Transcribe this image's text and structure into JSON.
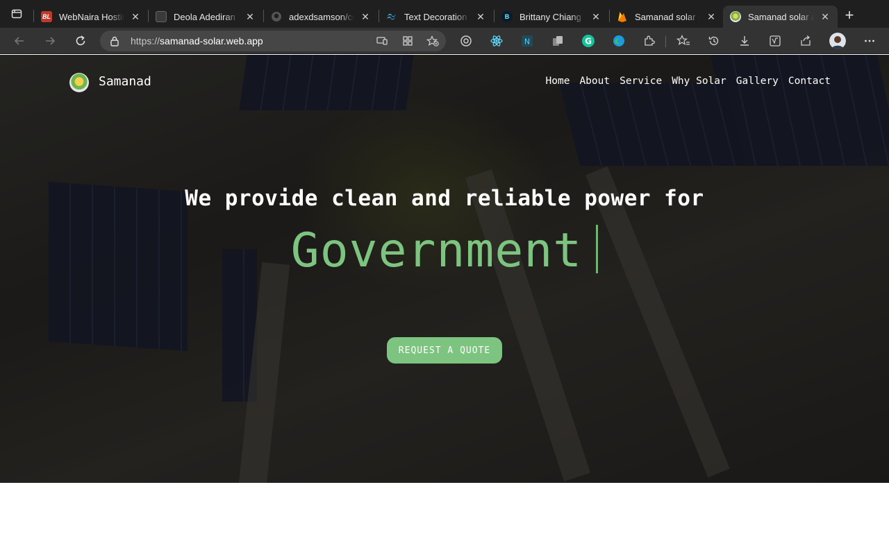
{
  "browser": {
    "tabs": [
      {
        "title": "WebNaira Hosting",
        "favicon": "bl-logo-icon",
        "fav_text": "BL",
        "color": "#c0392b"
      },
      {
        "title": "Deola Adediran | A",
        "favicon": "dark-square-icon",
        "fav_text": "",
        "color": "#444444"
      },
      {
        "title": "adexdsamson/cre",
        "favicon": "github-icon",
        "fav_text": "",
        "color": "#1f1f1f"
      },
      {
        "title": "Text Decoration -",
        "favicon": "tailwind-icon",
        "fav_text": "",
        "color": "#38bdf8"
      },
      {
        "title": "Brittany Chiang",
        "favicon": "b-logo-icon",
        "fav_text": "B",
        "color": "#0b1a33"
      },
      {
        "title": "Samanad solar – F",
        "favicon": "firebase-icon",
        "fav_text": "",
        "color": "#f5a623"
      },
      {
        "title": "Samanad solar an",
        "favicon": "samanad-logo-icon",
        "fav_text": "",
        "color": "#7cc47f"
      }
    ],
    "active_tab": 6,
    "address": {
      "scheme": "https://",
      "host": "samanad-solar.web.app"
    }
  },
  "page": {
    "brand": "Samanad",
    "nav": [
      "Home",
      "About",
      "Service",
      "Why Solar",
      "Gallery",
      "Contact"
    ],
    "headline": "We provide clean and reliable power for",
    "typed_word": "Government",
    "cta_label": "REQUEST A QUOTE",
    "accent_color": "#7cc47f"
  }
}
